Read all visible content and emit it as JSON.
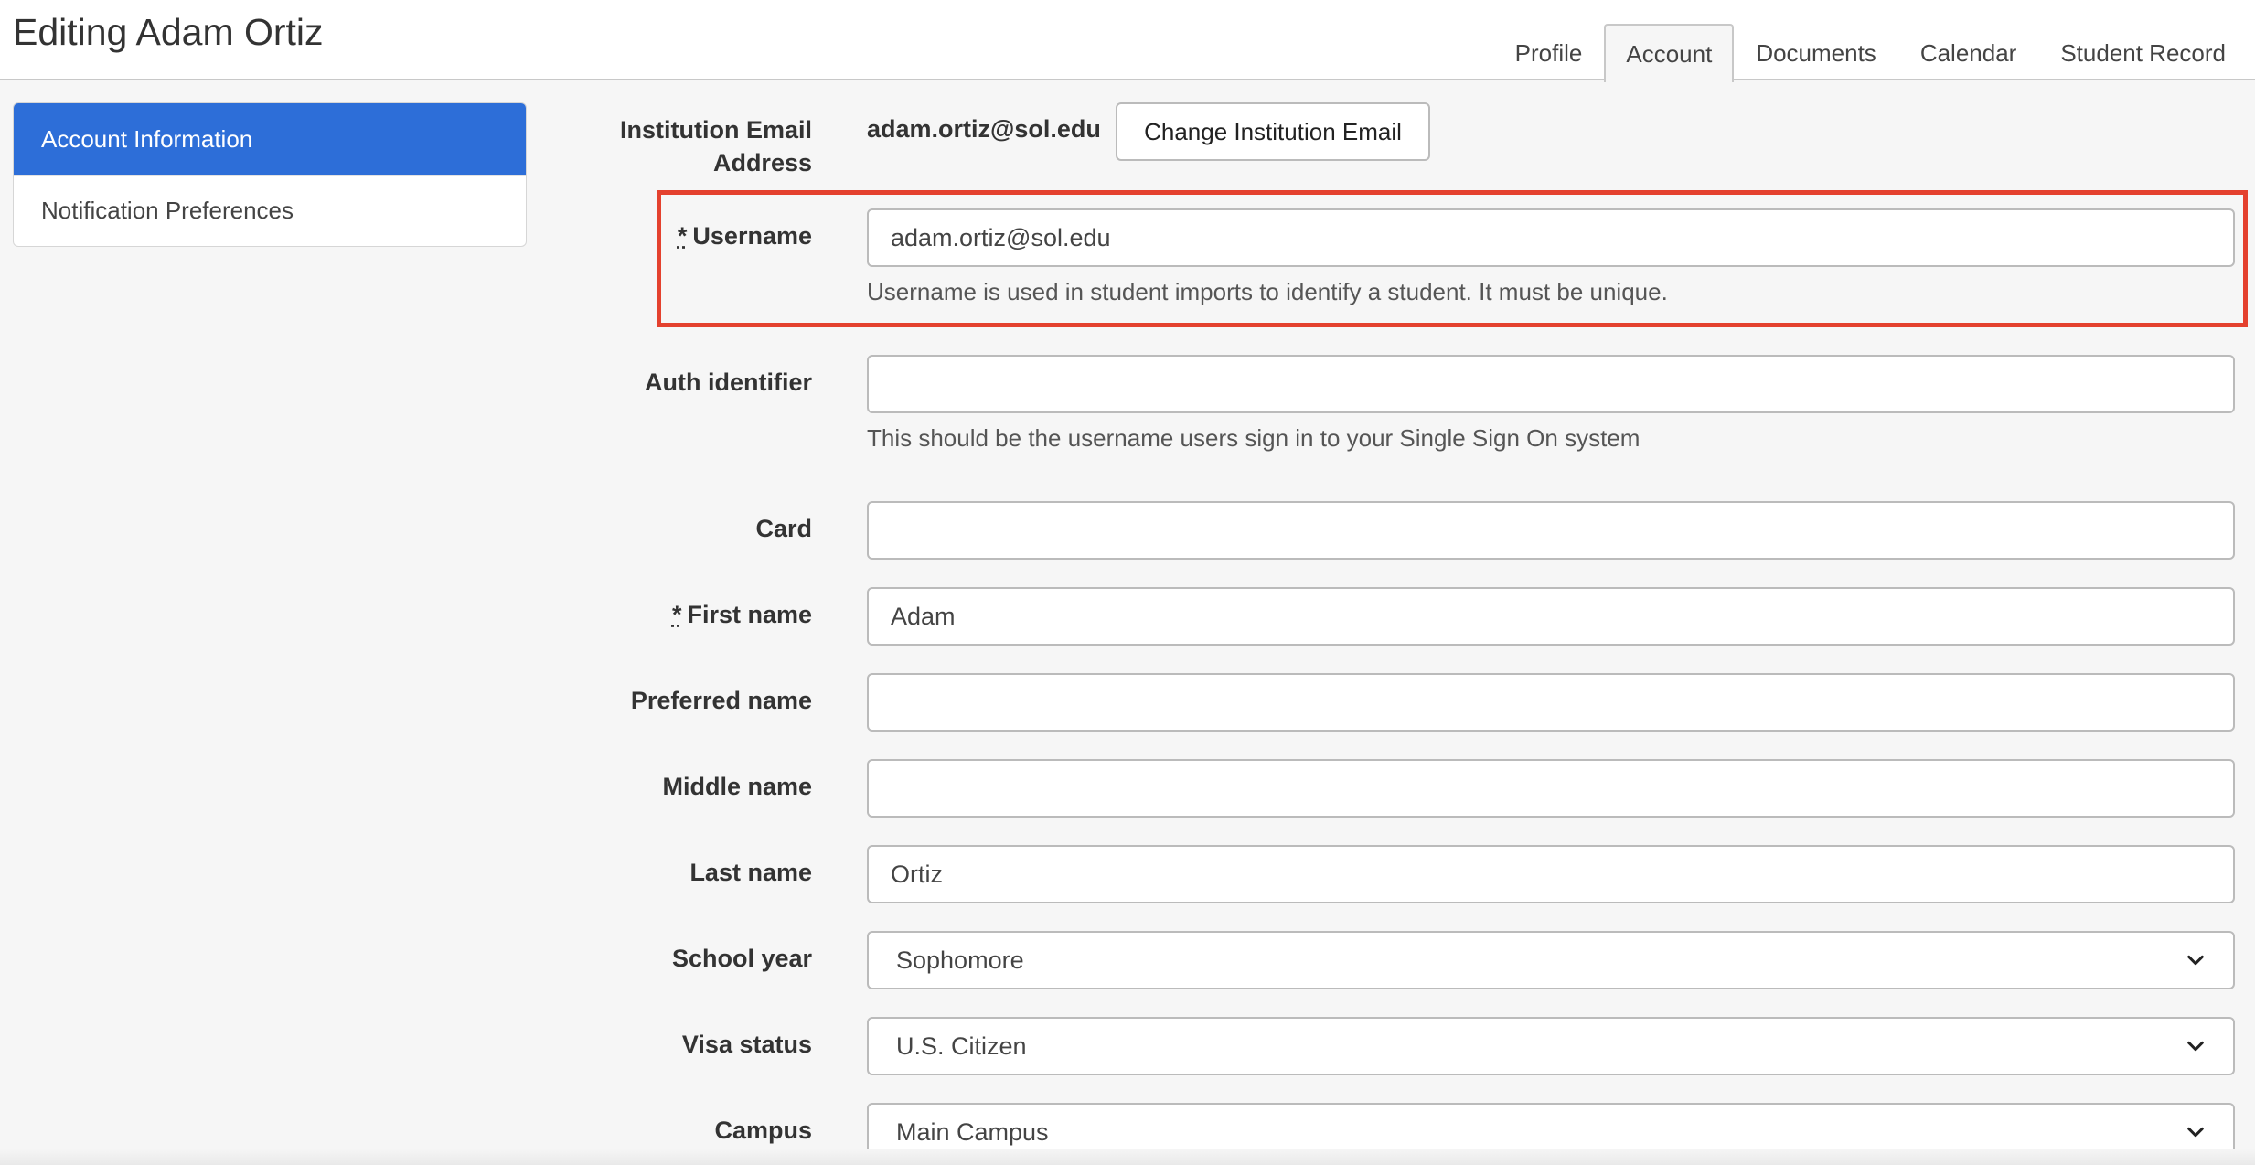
{
  "header": {
    "title": "Editing Adam Ortiz",
    "tabs": [
      {
        "label": "Profile",
        "active": false
      },
      {
        "label": "Account",
        "active": true
      },
      {
        "label": "Documents",
        "active": false
      },
      {
        "label": "Calendar",
        "active": false
      },
      {
        "label": "Student Record",
        "active": false
      }
    ]
  },
  "sidebar": {
    "items": [
      {
        "label": "Account Information",
        "active": true
      },
      {
        "label": "Notification Preferences",
        "active": false
      }
    ]
  },
  "form": {
    "institution_email": {
      "label_line1": "Institution Email",
      "label_line2": "Address",
      "value": "adam.ortiz@sol.edu",
      "button": "Change Institution Email"
    },
    "username": {
      "required_mark": "*",
      "label": "Username",
      "value": "adam.ortiz@sol.edu",
      "help": "Username is used in student imports to identify a student. It must be unique."
    },
    "auth_identifier": {
      "label": "Auth identifier",
      "value": "",
      "help": "This should be the username users sign in to your Single Sign On system"
    },
    "card": {
      "label": "Card",
      "value": ""
    },
    "first_name": {
      "required_mark": "*",
      "label": "First name",
      "value": "Adam"
    },
    "preferred_name": {
      "label": "Preferred name",
      "value": ""
    },
    "middle_name": {
      "label": "Middle name",
      "value": ""
    },
    "last_name": {
      "label": "Last name",
      "value": "Ortiz"
    },
    "school_year": {
      "label": "School year",
      "value": "Sophomore"
    },
    "visa_status": {
      "label": "Visa status",
      "value": "U.S. Citizen"
    },
    "campus": {
      "label": "Campus",
      "value": "Main Campus"
    }
  },
  "colors": {
    "accent": "#2d6ed8",
    "highlight": "#e4412e"
  }
}
